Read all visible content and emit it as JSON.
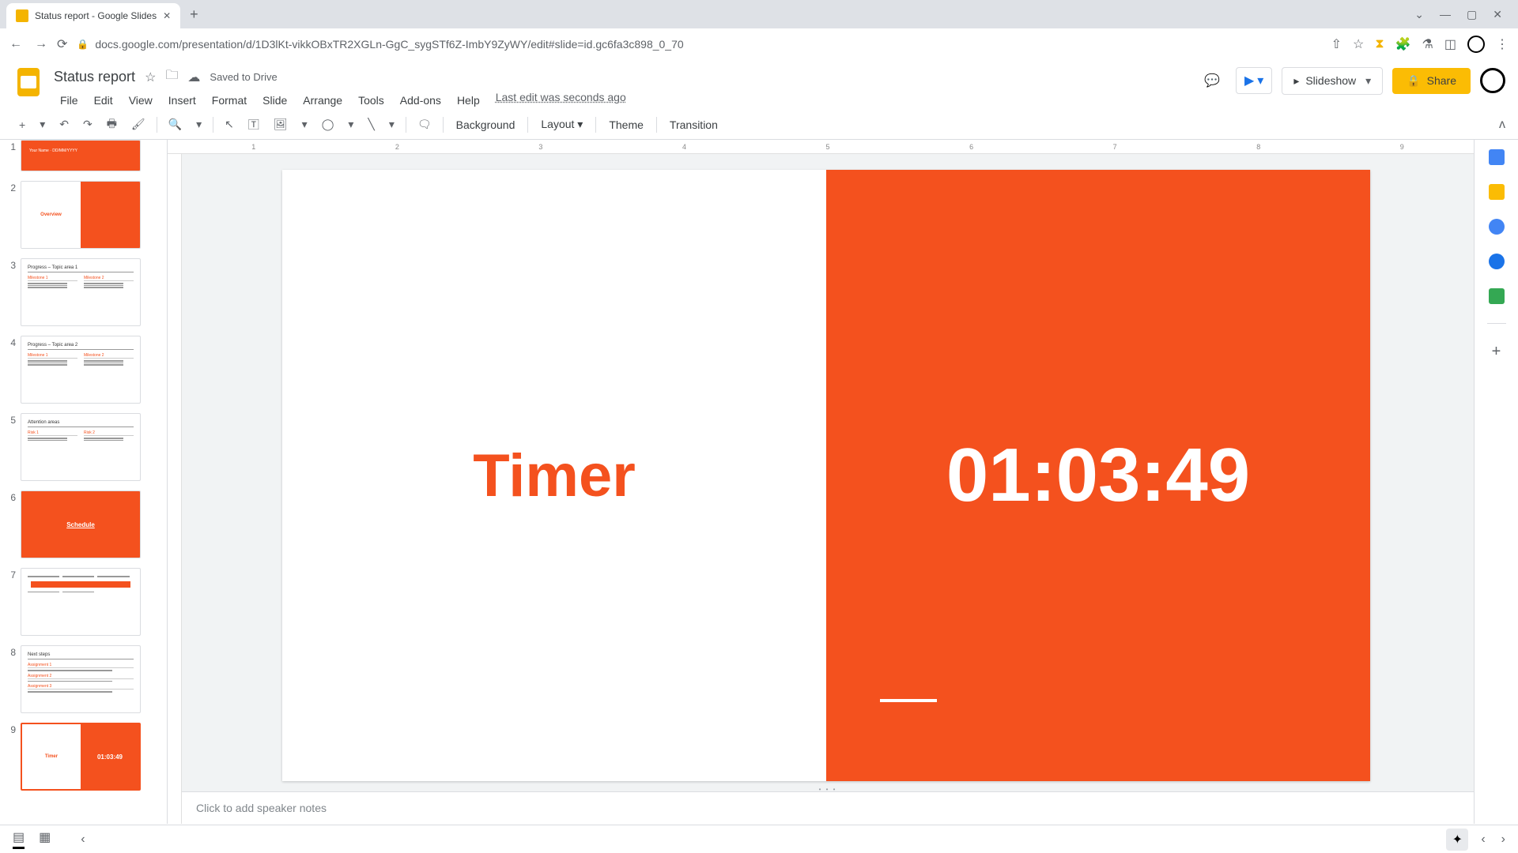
{
  "browser": {
    "tab_title": "Status report - Google Slides",
    "url": "docs.google.com/presentation/d/1D3lKt-vikkOBxTR2XGLn-GgC_sygSTf6Z-ImbY9ZyWY/edit#slide=id.gc6fa3c898_0_70"
  },
  "doc": {
    "title": "Status report",
    "saved": "Saved to Drive",
    "last_edit": "Last edit was seconds ago"
  },
  "menus": [
    "File",
    "Edit",
    "View",
    "Insert",
    "Format",
    "Slide",
    "Arrange",
    "Tools",
    "Add-ons",
    "Help"
  ],
  "header_buttons": {
    "slideshow": "Slideshow",
    "share": "Share"
  },
  "toolbar": {
    "background": "Background",
    "layout": "Layout",
    "theme": "Theme",
    "transition": "Transition"
  },
  "ruler_marks": [
    "1",
    "2",
    "3",
    "4",
    "5",
    "6",
    "7",
    "8",
    "9"
  ],
  "thumbnails": [
    {
      "num": "1",
      "type": "orange-full",
      "label": ""
    },
    {
      "num": "2",
      "type": "split",
      "left": "Overview",
      "right": ""
    },
    {
      "num": "3",
      "type": "two-col",
      "title": "Progress – Topic area 1"
    },
    {
      "num": "4",
      "type": "two-col",
      "title": "Progress – Topic area 2"
    },
    {
      "num": "5",
      "type": "two-col",
      "title": "Attention areas"
    },
    {
      "num": "6",
      "type": "orange-full",
      "label": "Schedule"
    },
    {
      "num": "7",
      "type": "timeline",
      "title": ""
    },
    {
      "num": "8",
      "type": "list",
      "title": "Next steps"
    },
    {
      "num": "9",
      "type": "split",
      "left": "Timer",
      "right": "01:03:49",
      "selected": true
    }
  ],
  "slide": {
    "title": "Timer",
    "timer_value": "01:03:49"
  },
  "notes_placeholder": "Click to add speaker notes",
  "colors": {
    "accent": "#f4511e",
    "share": "#fbbc04"
  }
}
